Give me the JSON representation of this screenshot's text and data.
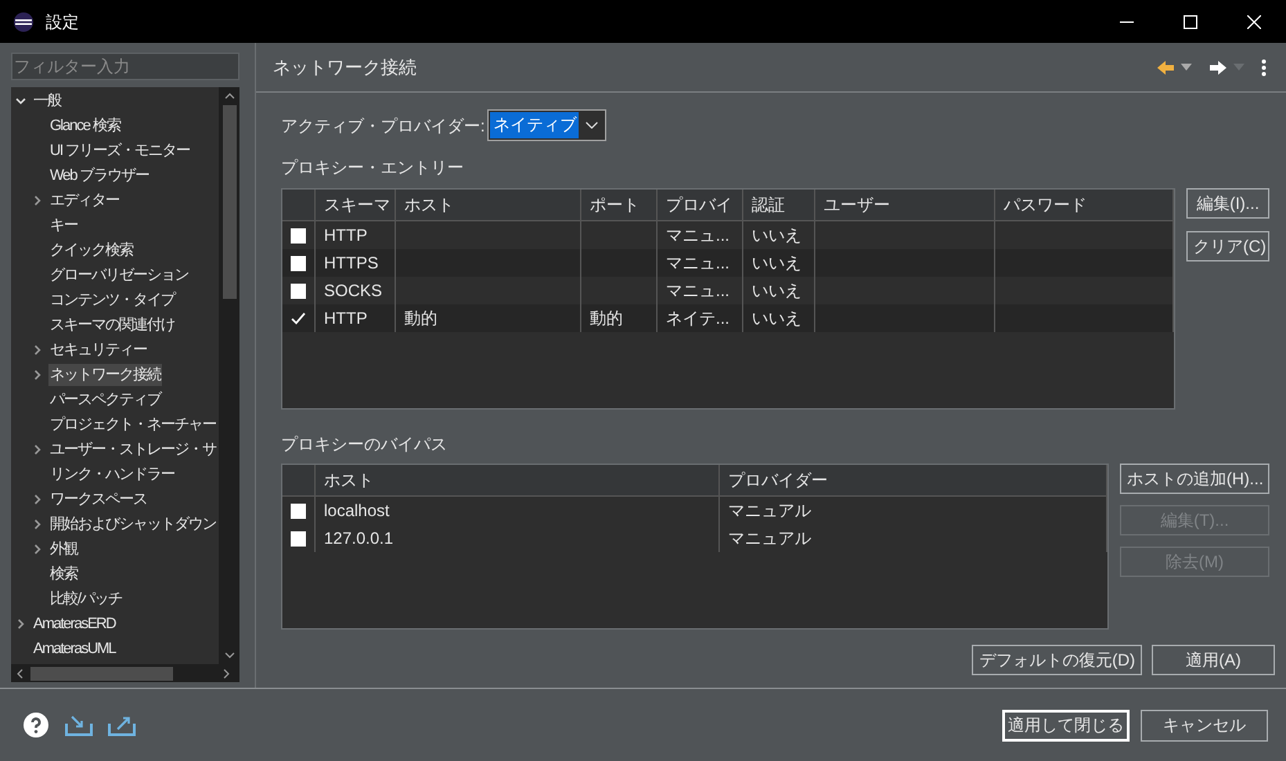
{
  "window": {
    "title": "設定"
  },
  "filter": {
    "placeholder": "フィルター入力"
  },
  "tree": [
    {
      "label": "一般",
      "expanded": true,
      "selected": false,
      "children": [
        {
          "label": "Glance 検索",
          "selected": false
        },
        {
          "label": "UI フリーズ・モニター",
          "selected": false
        },
        {
          "label": "Web ブラウザー",
          "selected": false
        },
        {
          "label": "エディター",
          "expanded": false,
          "selected": false
        },
        {
          "label": "キー",
          "selected": false
        },
        {
          "label": "クイック検索",
          "selected": false
        },
        {
          "label": "グローバリゼーション",
          "selected": false
        },
        {
          "label": "コンテンツ・タイプ",
          "selected": false
        },
        {
          "label": "スキーマの関連付け",
          "selected": false
        },
        {
          "label": "セキュリティー",
          "expanded": false,
          "selected": false
        },
        {
          "label": "ネットワーク接続",
          "expanded": false,
          "selected": true
        },
        {
          "label": "パースペクティブ",
          "selected": false
        },
        {
          "label": "プロジェクト・ネーチャー",
          "selected": false
        },
        {
          "label": "ユーザー・ストレージ・サ",
          "expanded": false,
          "selected": false
        },
        {
          "label": "リンク・ハンドラー",
          "selected": false
        },
        {
          "label": "ワークスペース",
          "expanded": false,
          "selected": false
        },
        {
          "label": "開始およびシャットダウン",
          "expanded": false,
          "selected": false
        },
        {
          "label": "外観",
          "expanded": false,
          "selected": false
        },
        {
          "label": "検索",
          "selected": false
        },
        {
          "label": "比較/パッチ",
          "selected": false
        }
      ]
    },
    {
      "label": "AmaterasERD",
      "expanded": false,
      "selected": false
    },
    {
      "label": "AmaterasUML",
      "selected": false
    }
  ],
  "page_title": "ネットワーク接続",
  "active_provider": {
    "label": "アクティブ・プロバイダー:",
    "value": "ネイティブ"
  },
  "proxy_entries": {
    "title": "プロキシー・エントリー",
    "columns": [
      "スキーマ",
      "ホスト",
      "ポート",
      "プロバイ",
      "認証",
      "ユーザー",
      "パスワード"
    ],
    "rows": [
      {
        "checked": false,
        "cells": [
          "HTTP",
          "",
          "",
          "マニュ...",
          "いいえ",
          "",
          ""
        ]
      },
      {
        "checked": false,
        "cells": [
          "HTTPS",
          "",
          "",
          "マニュ...",
          "いいえ",
          "",
          ""
        ]
      },
      {
        "checked": false,
        "cells": [
          "SOCKS",
          "",
          "",
          "マニュ...",
          "いいえ",
          "",
          ""
        ]
      },
      {
        "checked": true,
        "cells": [
          "HTTP",
          "動的",
          "動的",
          "ネイテ...",
          "いいえ",
          "",
          ""
        ]
      }
    ],
    "buttons": [
      {
        "label": "編集(I)...",
        "disabled": false
      },
      {
        "label": "クリア(C)",
        "disabled": false
      }
    ]
  },
  "proxy_bypass": {
    "title": "プロキシーのバイパス",
    "columns": [
      "ホスト",
      "プロバイダー"
    ],
    "rows": [
      {
        "checked": false,
        "cells": [
          "localhost",
          "マニュアル"
        ]
      },
      {
        "checked": false,
        "cells": [
          "127.0.0.1",
          "マニュアル"
        ]
      }
    ],
    "buttons": [
      {
        "label": "ホストの追加(H)...",
        "disabled": false
      },
      {
        "label": "編集(T)...",
        "disabled": true
      },
      {
        "label": "除去(M)",
        "disabled": true
      }
    ]
  },
  "page_buttons": [
    "デフォルトの復元(D)",
    "適用(A)"
  ],
  "dialog_buttons": [
    {
      "label": "適用して閉じる",
      "default": true
    },
    {
      "label": "キャンセル",
      "default": false
    }
  ]
}
